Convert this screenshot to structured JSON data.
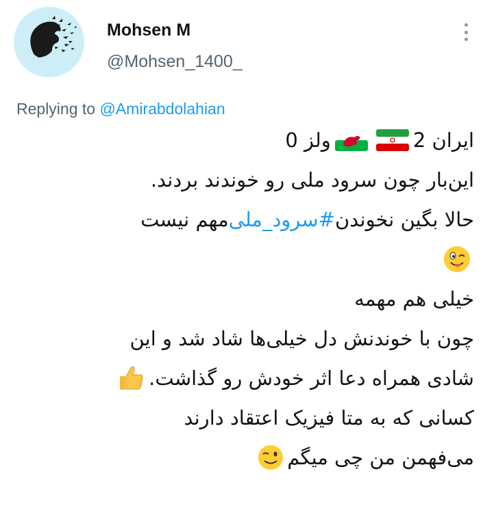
{
  "tweet_header": {
    "display_name": "Mohsen M",
    "handle": "@Mohsen_1400_",
    "more_icon": "more-vertical-icon"
  },
  "reply": {
    "prefix": "Replying to ",
    "mention": "@Amirabdolahian"
  },
  "tweet": {
    "line1_iran": "ایران 2",
    "line1_wales": "ولز 0",
    "line2": "این‌بار چون سرود ملی رو خوندند بردند.",
    "line3_before": "حالا بگین نخوندن ",
    "line3_hashtag": "#سرود_ملی",
    "line3_after": " مهم نیست",
    "line4_emoji": "winking-face-with-tongue",
    "line5": "خیلی هم مهمه",
    "line6": "چون با خوندنش دل خیلی‌ها شاد شد و این",
    "line7": "شادی همراه دعا اثر خودش رو گذاشت.",
    "line7_emoji": "thumbs-up",
    "line8": "کسانی که به متا فیزیک اعتقاد دارند",
    "line9": "می‌فهمن من چی میگم",
    "line9_emoji": "winking-face",
    "flags": [
      "iran-flag",
      "wales-flag"
    ]
  },
  "colors": {
    "text": "#0f1419",
    "secondary": "#536471",
    "link": "#1d9bf0",
    "avatar_bg": "#cdeef6"
  }
}
